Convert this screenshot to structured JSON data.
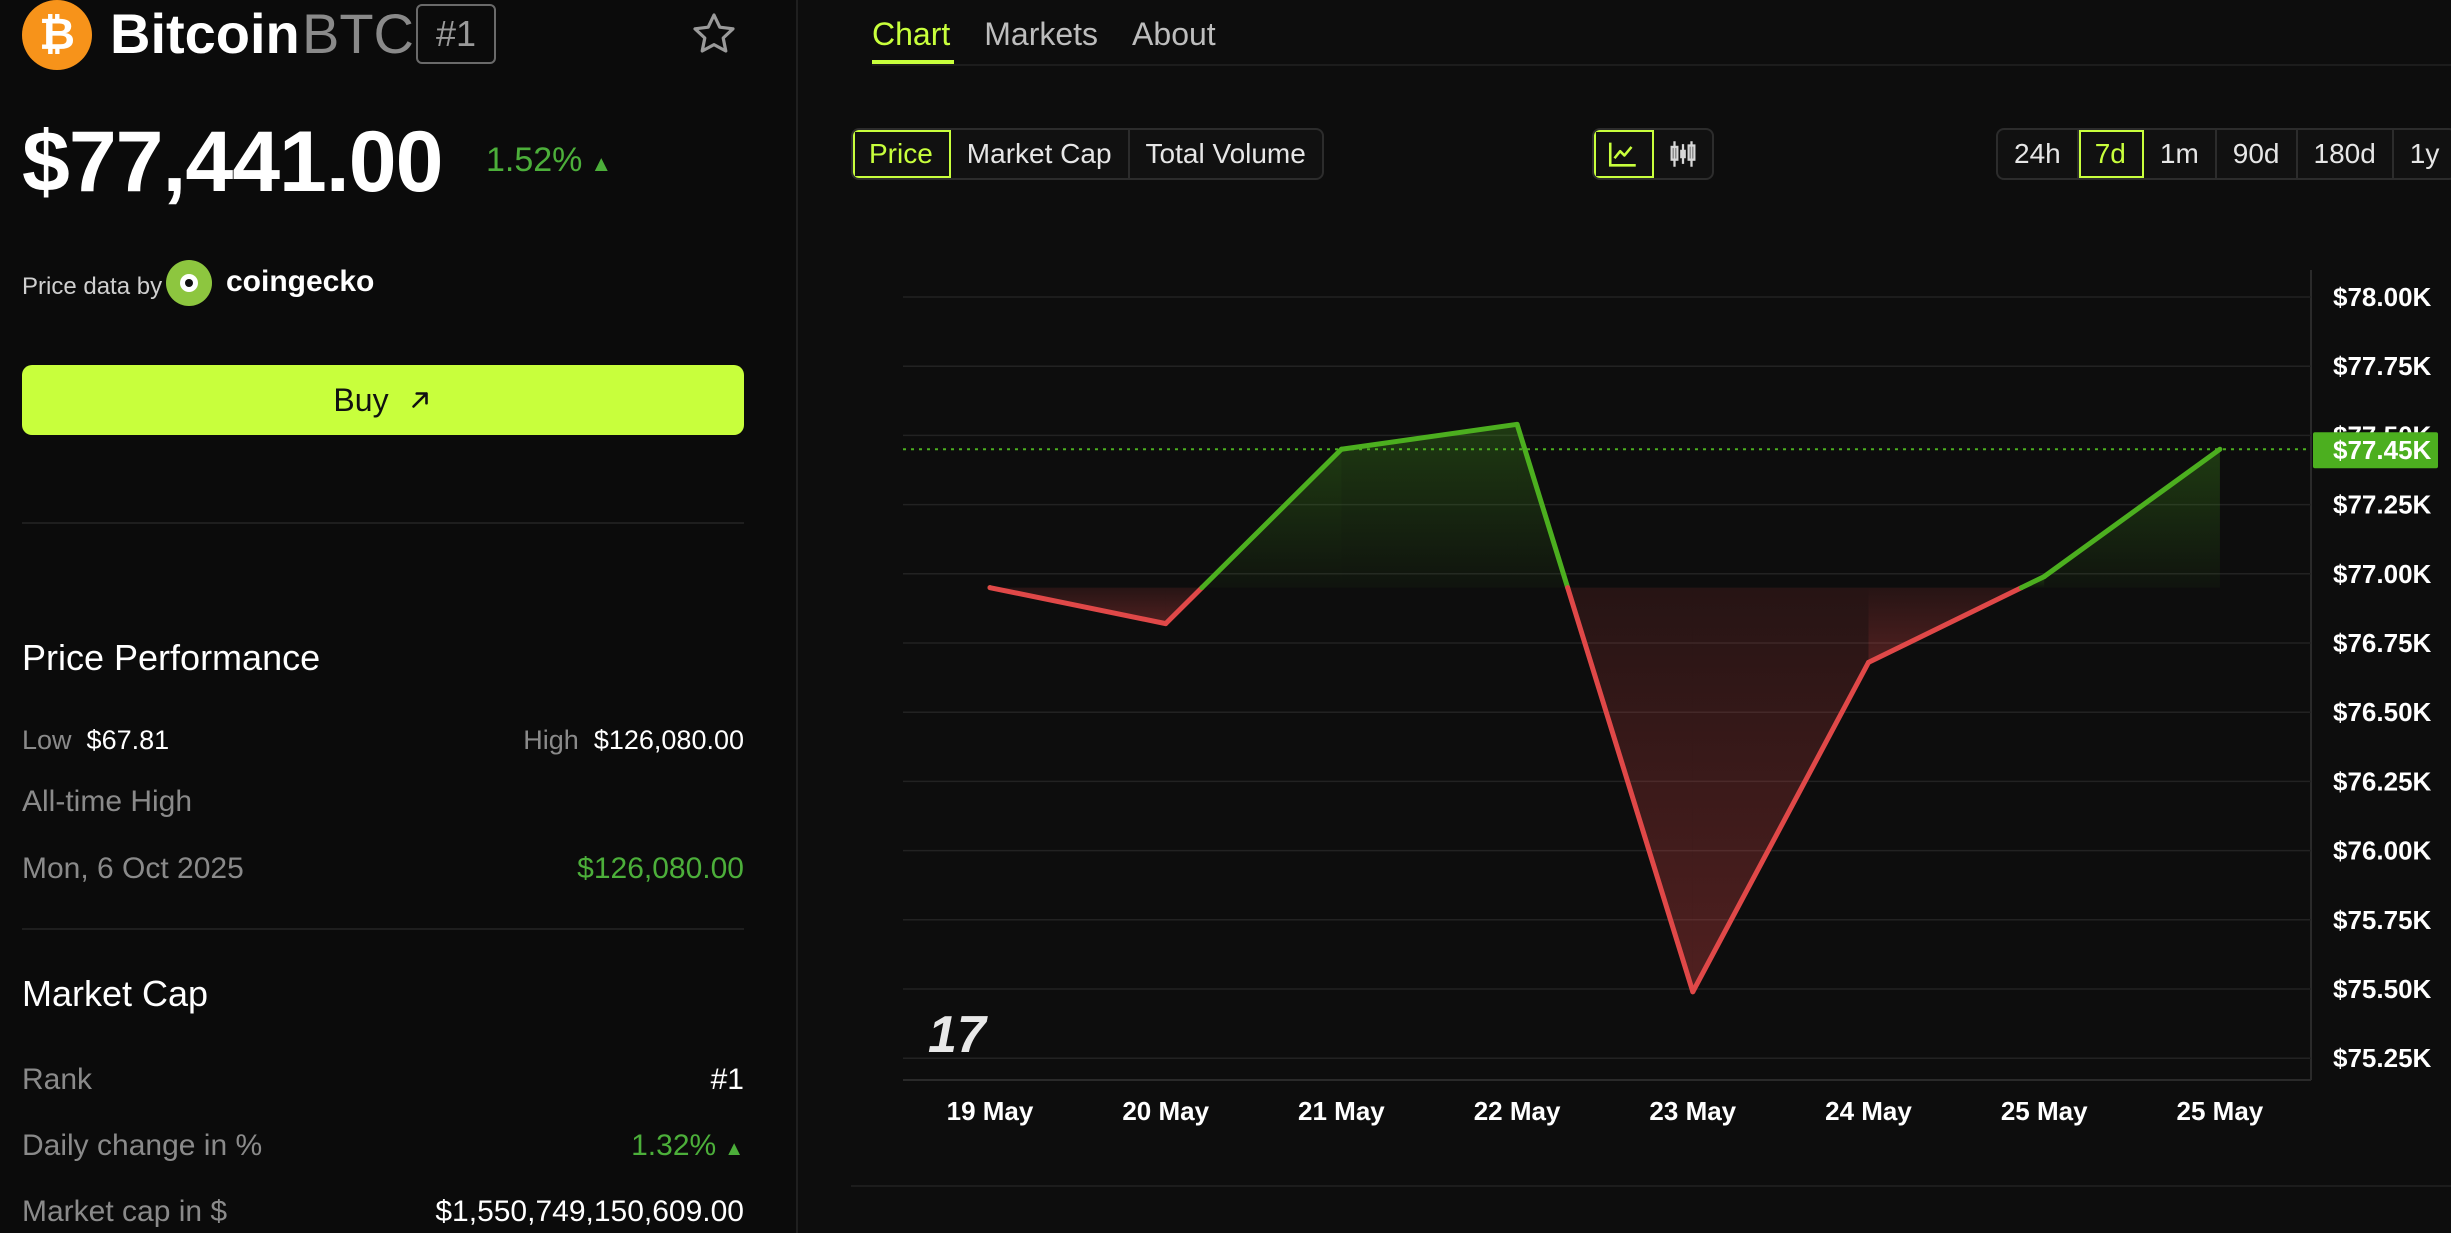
{
  "coin": {
    "name": "Bitcoin",
    "symbol": "BTC",
    "rank_badge": "#1",
    "logo_glyph": "₿",
    "price": "$77,441.00",
    "change_pct": "1.52%",
    "change_arrow": "▲",
    "brand_color": "#f7931a"
  },
  "price_source": {
    "label": "Price data by",
    "provider": "coingecko"
  },
  "buy_button": {
    "label": "Buy",
    "icon": "arrow-up-right-icon",
    "color": "#c8ff3c"
  },
  "performance": {
    "title": "Price Performance",
    "low_label": "Low",
    "low_value": "$67.81",
    "high_label": "High",
    "high_value": "$126,080.00",
    "ath_label": "All-time High",
    "ath_date": "Mon, 6 Oct 2025",
    "ath_value": "$126,080.00"
  },
  "market_cap": {
    "title": "Market Cap",
    "rank_label": "Rank",
    "rank_value": "#1",
    "daily_change_label": "Daily change in %",
    "daily_change_value": "1.32%",
    "daily_change_arrow": "▲",
    "cap_label": "Market cap in $",
    "cap_value": "$1,550,749,150,609.00"
  },
  "tabs": [
    {
      "label": "Chart",
      "active": true
    },
    {
      "label": "Markets",
      "active": false
    },
    {
      "label": "About",
      "active": false
    }
  ],
  "metric_buttons": [
    {
      "label": "Price",
      "active": true
    },
    {
      "label": "Market Cap",
      "active": false
    },
    {
      "label": "Total Volume",
      "active": false
    }
  ],
  "chart_style_buttons": [
    {
      "icon": "line-chart-icon",
      "active": true
    },
    {
      "icon": "candlestick-icon",
      "active": false
    }
  ],
  "range_buttons": [
    {
      "label": "24h",
      "active": false
    },
    {
      "label": "7d",
      "active": true
    },
    {
      "label": "1m",
      "active": false
    },
    {
      "label": "90d",
      "active": false
    },
    {
      "label": "180d",
      "active": false
    },
    {
      "label": "1y",
      "active": false
    }
  ],
  "chart_data": {
    "type": "line",
    "x": [
      "19 May",
      "20 May",
      "21 May",
      "22 May",
      "23 May",
      "24 May",
      "25 May",
      "25 May"
    ],
    "series": [
      {
        "values": [
          76950,
          76820,
          77450,
          77540,
          75490,
          76680,
          76990,
          77450
        ]
      }
    ],
    "baseline": 76950,
    "current_price_label": "$77.45K",
    "current_price": 77450,
    "y_ticks": [
      "$78.00K",
      "$77.75K",
      "$77.50K",
      "$77.25K",
      "$77.00K",
      "$76.75K",
      "$76.50K",
      "$76.25K",
      "$76.00K",
      "$75.75K",
      "$75.50K",
      "$75.25K"
    ],
    "ylim": [
      75200,
      78050
    ],
    "up_color": "#4caf1f",
    "down_color": "#e04848",
    "watermark": "17"
  }
}
